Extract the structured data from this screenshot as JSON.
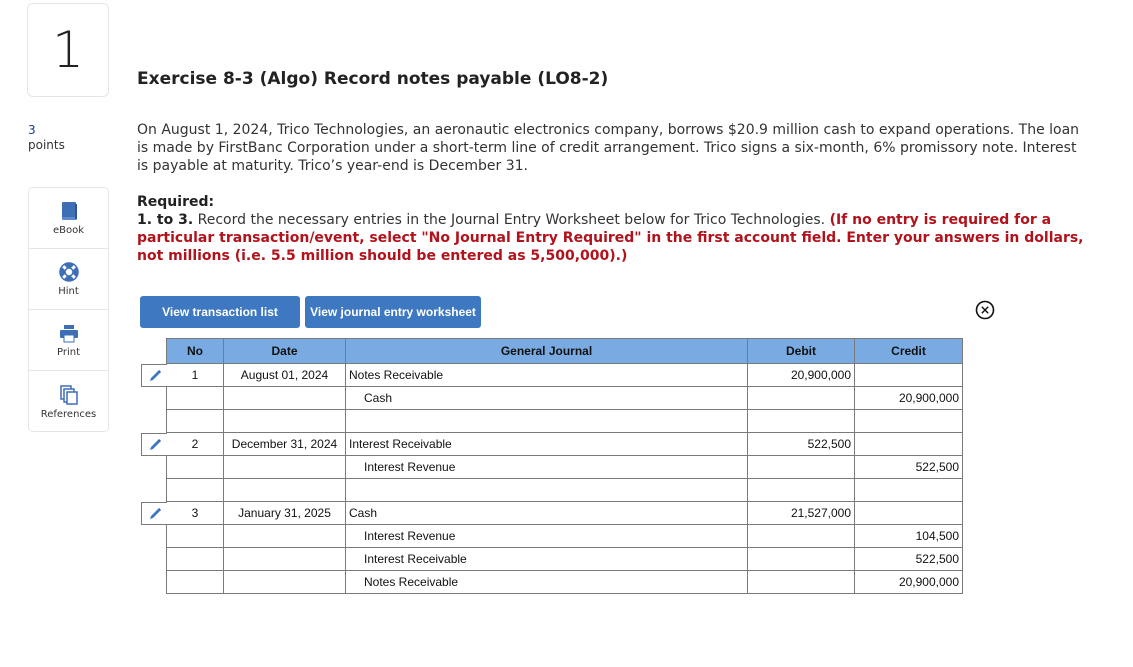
{
  "question": {
    "number": "1",
    "points_value": "3",
    "points_label": "points"
  },
  "tools": [
    {
      "label": "eBook",
      "icon": "book-icon"
    },
    {
      "label": "Hint",
      "icon": "lifebuoy-icon"
    },
    {
      "label": "Print",
      "icon": "printer-icon"
    },
    {
      "label": "References",
      "icon": "copy-documents-icon"
    }
  ],
  "title": "Exercise 8-3 (Algo) Record notes payable (LO8-2)",
  "intro": "On August 1, 2024, Trico Technologies, an aeronautic electronics company, borrows $20.9 million cash to expand operations. The loan is made by FirstBanc Corporation under a short-term line of credit arrangement. Trico signs a six-month, 6% promissory note. Interest is payable at maturity. Trico’s year-end is December 31.",
  "required": {
    "heading": "Required:",
    "step": "1. to 3.",
    "text": " Record the necessary entries in the Journal Entry Worksheet below for Trico Technologies. ",
    "note": "(If no entry is required for a particular transaction/event, select \"No Journal Entry Required\" in the first account field. Enter your answers in dollars, not millions (i.e. 5.5 million should be entered as 5,500,000).)"
  },
  "buttons": {
    "view_transaction_list": "View transaction list",
    "view_journal_entry_worksheet": "View journal entry worksheet"
  },
  "colors": {
    "button_bg": "#3e78c0",
    "table_header_bg": "#79abe2",
    "instruction_red": "#b2121b",
    "edit_icon": "#3e78c0"
  },
  "journal": {
    "headers": {
      "no": "No",
      "date": "Date",
      "account": "General Journal",
      "debit": "Debit",
      "credit": "Credit"
    },
    "rows": [
      {
        "no": "1",
        "date": "August 01, 2024",
        "account": "Notes Receivable",
        "debit": "20,900,000",
        "credit": "",
        "indent": false,
        "editable": true
      },
      {
        "no": "",
        "date": "",
        "account": "Cash",
        "debit": "",
        "credit": "20,900,000",
        "indent": true,
        "editable": false
      },
      {
        "spacer": true
      },
      {
        "no": "2",
        "date": "December 31, 2024",
        "account": "Interest Receivable",
        "debit": "522,500",
        "credit": "",
        "indent": false,
        "editable": true
      },
      {
        "no": "",
        "date": "",
        "account": "Interest Revenue",
        "debit": "",
        "credit": "522,500",
        "indent": true,
        "editable": false
      },
      {
        "spacer": true
      },
      {
        "no": "3",
        "date": "January 31, 2025",
        "account": "Cash",
        "debit": "21,527,000",
        "credit": "",
        "indent": false,
        "editable": true
      },
      {
        "no": "",
        "date": "",
        "account": "Interest Revenue",
        "debit": "",
        "credit": "104,500",
        "indent": true,
        "editable": false
      },
      {
        "no": "",
        "date": "",
        "account": "Interest Receivable",
        "debit": "",
        "credit": "522,500",
        "indent": true,
        "editable": false
      },
      {
        "no": "",
        "date": "",
        "account": "Notes Receivable",
        "debit": "",
        "credit": "20,900,000",
        "indent": true,
        "editable": false
      }
    ]
  }
}
